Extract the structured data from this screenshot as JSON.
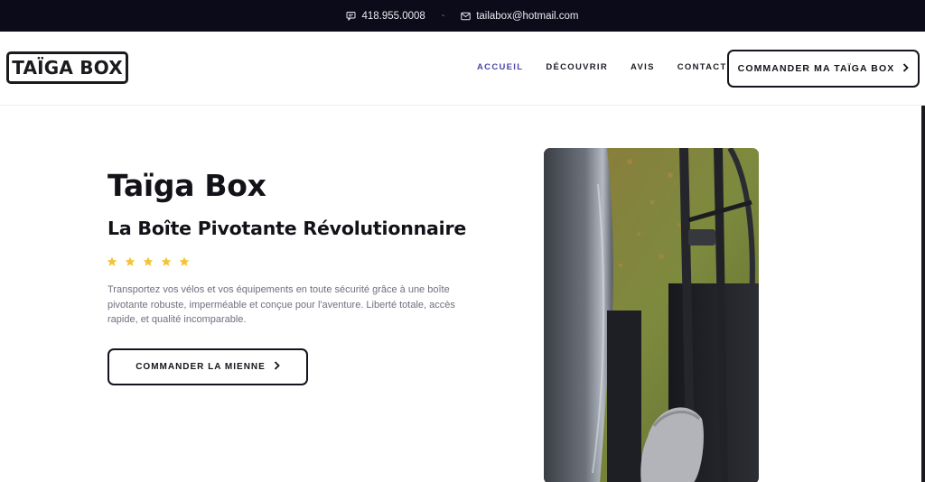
{
  "topbar": {
    "phone": "418.955.0008",
    "separator": "-",
    "email": "tailabox@hotmail.com",
    "phone_icon": "message-icon",
    "email_icon": "mail-icon"
  },
  "header": {
    "logo_text": "TAÏGA BOX",
    "nav": [
      {
        "label": "ACCUEIL",
        "active": true
      },
      {
        "label": "DÉCOUVRIR",
        "active": false
      },
      {
        "label": "AVIS",
        "active": false
      },
      {
        "label": "CONTACT",
        "active": false
      }
    ],
    "cta_label": "COMMANDER MA TAÏGA BOX",
    "cta_icon": "chevron-right-icon"
  },
  "hero": {
    "title": "Taïga Box",
    "subtitle": "La Boîte Pivotante Révolutionnaire",
    "rating": 5,
    "description": "Transportez vos vélos et vos équipements en toute sécurité grâce à une boîte pivotante robuste, imperméable et conçue pour l'aventure. Liberté totale, accès rapide, et qualité incomparable.",
    "cta_label": "COMMANDER LA MIENNE",
    "cta_icon": "chevron-right-icon",
    "image_icon": "product-photo"
  },
  "colors": {
    "topbar_bg": "#0c0b19",
    "accent_nav": "#4b45a8",
    "star": "#f2c43a",
    "text_dark": "#121219",
    "text_muted": "#6f7080"
  }
}
